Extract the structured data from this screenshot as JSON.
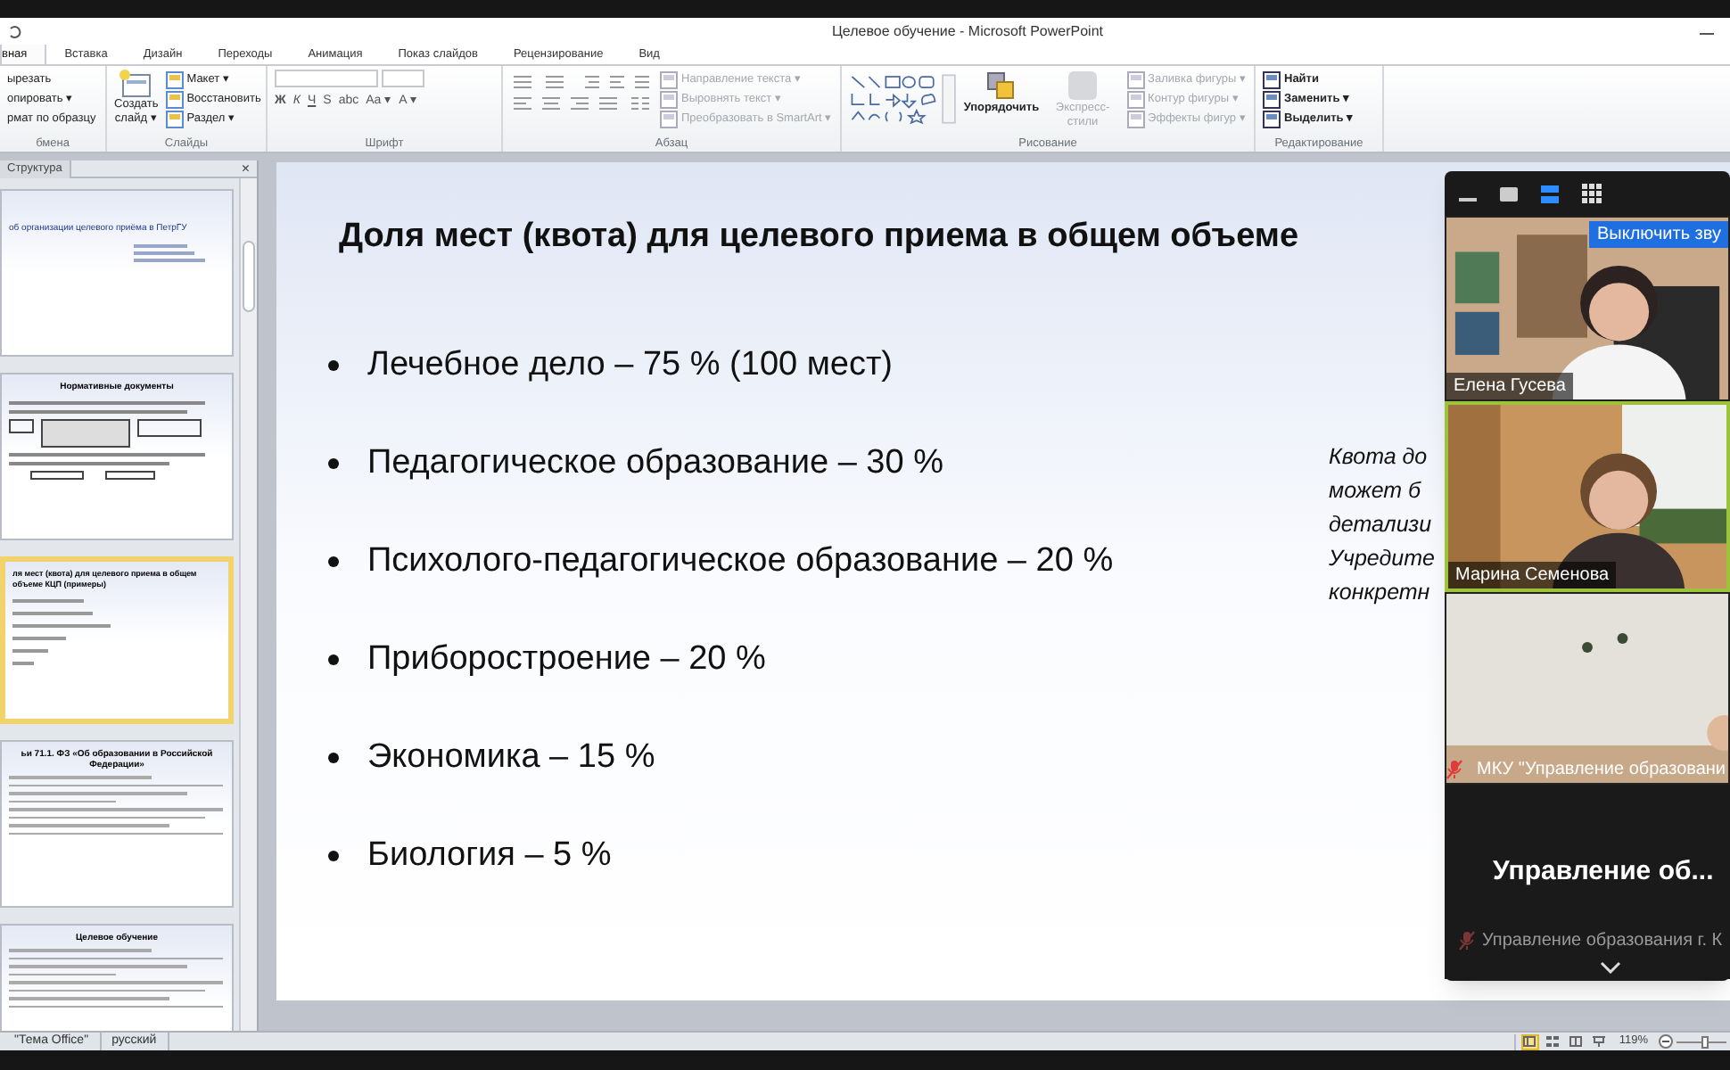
{
  "window": {
    "title": "Целевое обучение - Microsoft PowerPoint"
  },
  "ribbon_tabs": [
    {
      "label": "вная",
      "selected": true
    },
    {
      "label": "Вставка",
      "selected": false
    },
    {
      "label": "Дизайн",
      "selected": false
    },
    {
      "label": "Переходы",
      "selected": false
    },
    {
      "label": "Анимация",
      "selected": false
    },
    {
      "label": "Показ слайдов",
      "selected": false
    },
    {
      "label": "Рецензирование",
      "selected": false
    },
    {
      "label": "Вид",
      "selected": false
    }
  ],
  "clipboard": {
    "label": "бмена",
    "items": [
      "ырезать",
      "опировать ▾",
      "рмат по образцу"
    ]
  },
  "slides_group": {
    "label": "Слайды",
    "new_slide": "Создать слайд ▾",
    "items": [
      "Макет ▾",
      "Восстановить",
      "Раздел ▾"
    ]
  },
  "font_group": {
    "label": "Шрифт",
    "buttons": [
      "Ж",
      "К",
      "Ч",
      "S",
      "abc",
      "Aa ▾",
      "A ▾"
    ]
  },
  "paragraph_group": {
    "label": "Абзац",
    "items": [
      {
        "label": "Направление текста ▾",
        "disabled": true
      },
      {
        "label": "Выровнять текст ▾",
        "disabled": true
      },
      {
        "label": "Преобразовать в SmartArt ▾",
        "disabled": true
      }
    ]
  },
  "drawing_group": {
    "label": "Рисование",
    "arrange": "Упорядочить",
    "quick_styles": {
      "label": "Экспресс-стили",
      "disabled": true
    },
    "items": [
      {
        "label": "Заливка фигуры ▾",
        "disabled": true
      },
      {
        "label": "Контур фигуры ▾",
        "disabled": true
      },
      {
        "label": "Эффекты фигур ▾",
        "disabled": true
      }
    ]
  },
  "editing_group": {
    "label": "Редактирование",
    "items": [
      "Найти",
      "Заменить ▾",
      "Выделить ▾"
    ]
  },
  "outline_pane": {
    "tab": "Структура",
    "close": "×",
    "thumbnails": [
      {
        "title": "об организации  целевого приёма в ПетрГУ",
        "kind": "title",
        "selected": false
      },
      {
        "title": "Нормативные документы",
        "kind": "boxes",
        "selected": false
      },
      {
        "title": "ля мест (квота) для целевого приема в общем объеме КЦП (примеры)",
        "kind": "list",
        "selected": true
      },
      {
        "title": "ьи 71.1. ФЗ «Об образовании в Российской Федерации»",
        "kind": "text",
        "selected": false
      },
      {
        "title": "Целевое обучение",
        "kind": "text",
        "selected": false
      }
    ]
  },
  "slide": {
    "title": "Доля мест (квота) для целевого приема в общем объеме",
    "bullets": [
      "Лечебное дело – 75 % (100 мест)",
      "Педагогическое образование – 30 %",
      "Психолого-педагогическое образование – 20 %",
      "Приборостроение – 20 %",
      "Экономика – 15 %",
      "Биология – 5 %"
    ],
    "note_lines": [
      "Квота до",
      "может б",
      "детализи",
      "Учредите",
      "конкретн"
    ]
  },
  "meeting": {
    "tiles": [
      {
        "kind": "video",
        "name": "Елена Гусева",
        "active": false,
        "muted": false,
        "button": "Выключить зву"
      },
      {
        "kind": "video",
        "name": "Марина Семенова",
        "active": true,
        "muted": false
      },
      {
        "kind": "video",
        "name": "МКУ \"Управление образовани",
        "active": false,
        "muted": true
      },
      {
        "kind": "name",
        "title": "Управление об...",
        "footer": "Управление образования г. К",
        "active": false,
        "muted": true
      }
    ]
  },
  "status_bar": {
    "theme": "\"Тема Office\"",
    "language": "русский",
    "views": [
      {
        "kind": "normal",
        "selected": true
      },
      {
        "kind": "sorter",
        "selected": false
      },
      {
        "kind": "reading",
        "selected": false
      },
      {
        "kind": "show",
        "selected": false
      }
    ],
    "zoom": "119%",
    "zoom_slider": {
      "level": 0.6
    }
  }
}
